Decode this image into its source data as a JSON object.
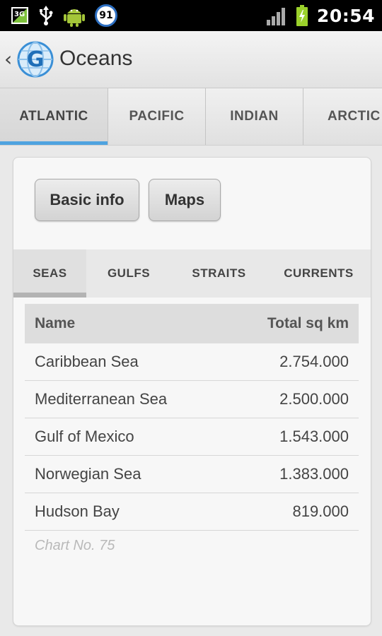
{
  "status_bar": {
    "left_icons": [
      "sim-3g-icon",
      "usb-icon",
      "android-debug-icon",
      "notification-badge-icon"
    ],
    "badge_value": "91",
    "sim_label": "3G",
    "right_icons": [
      "signal-icon",
      "battery-charging-icon"
    ],
    "time": "20:54"
  },
  "action_bar": {
    "back_icon": "chevron-left-icon",
    "logo_icon": "globe-logo-icon",
    "logo_letter": "G",
    "title": "Oceans"
  },
  "ocean_tabs": [
    {
      "label": "ATLANTIC",
      "active": true
    },
    {
      "label": "PACIFIC",
      "active": false
    },
    {
      "label": "INDIAN",
      "active": false
    },
    {
      "label": "ARCTIC",
      "active": false
    }
  ],
  "buttons": {
    "basic_info": "Basic info",
    "maps": "Maps"
  },
  "sub_tabs": [
    {
      "label": "SEAS",
      "active": true
    },
    {
      "label": "GULFS",
      "active": false
    },
    {
      "label": "STRAITS",
      "active": false
    },
    {
      "label": "CURRENTS",
      "active": false
    }
  ],
  "table": {
    "headers": {
      "name": "Name",
      "area": "Total sq km"
    },
    "rows": [
      {
        "name": "Caribbean Sea",
        "area": "2.754.000"
      },
      {
        "name": "Mediterranean Sea",
        "area": "2.500.000"
      },
      {
        "name": "Gulf of Mexico",
        "area": "1.543.000"
      },
      {
        "name": "Norwegian Sea",
        "area": "1.383.000"
      },
      {
        "name": "Hudson Bay",
        "area": "819.000"
      }
    ]
  },
  "caption": "Chart No. 75",
  "colors": {
    "tab_indicator": "#4fa3e0",
    "status_bar": "#000000",
    "battery": "#9bd12b"
  }
}
